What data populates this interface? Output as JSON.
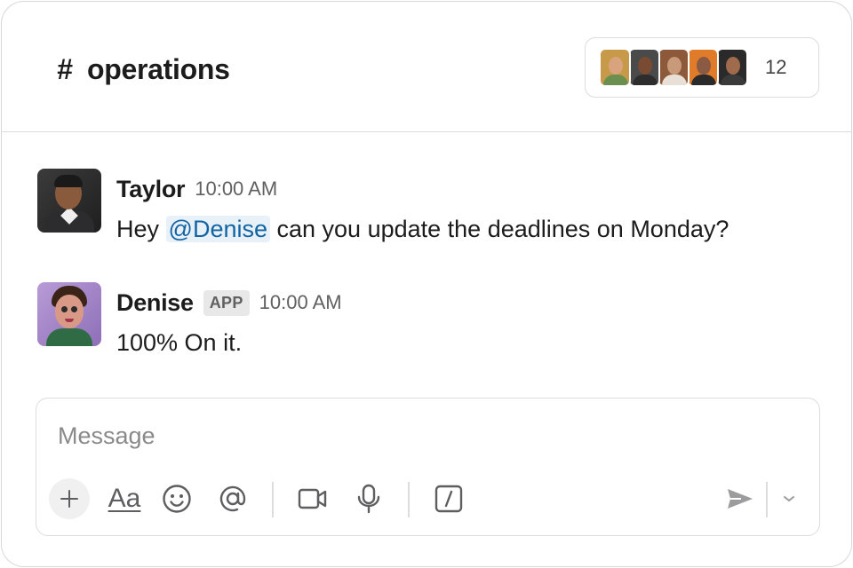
{
  "channel": {
    "hash": "#",
    "name": "operations",
    "member_count": "12",
    "member_avatars": [
      {
        "face": "#d9a37e",
        "body": "#6b8f4e",
        "bg": "#c79a4a"
      },
      {
        "face": "#7a4b33",
        "body": "#2d2d2d",
        "bg": "#4a4a4a"
      },
      {
        "face": "#c99a7a",
        "body": "#e8e0d6",
        "bg": "#8c5a3a"
      },
      {
        "face": "#8a5a45",
        "body": "#2a2a2a",
        "bg": "#e07b2a"
      },
      {
        "face": "#a06a4c",
        "body": "#3a3a3a",
        "bg": "#2a2a2a"
      }
    ]
  },
  "messages": [
    {
      "author": "Taylor",
      "time": "10:00 AM",
      "text_before": "Hey ",
      "mention": "@Denise",
      "text_after": " can you update the deadlines on Monday?"
    },
    {
      "author": "Denise",
      "badge": "APP",
      "time": "10:00 AM",
      "text": "100% On it."
    }
  ],
  "composer": {
    "placeholder": "Message",
    "format_label": "Aa"
  },
  "colors": {
    "mention_text": "#1264a3",
    "mention_bg": "#e8f0f8",
    "border": "#dcdcdc"
  }
}
